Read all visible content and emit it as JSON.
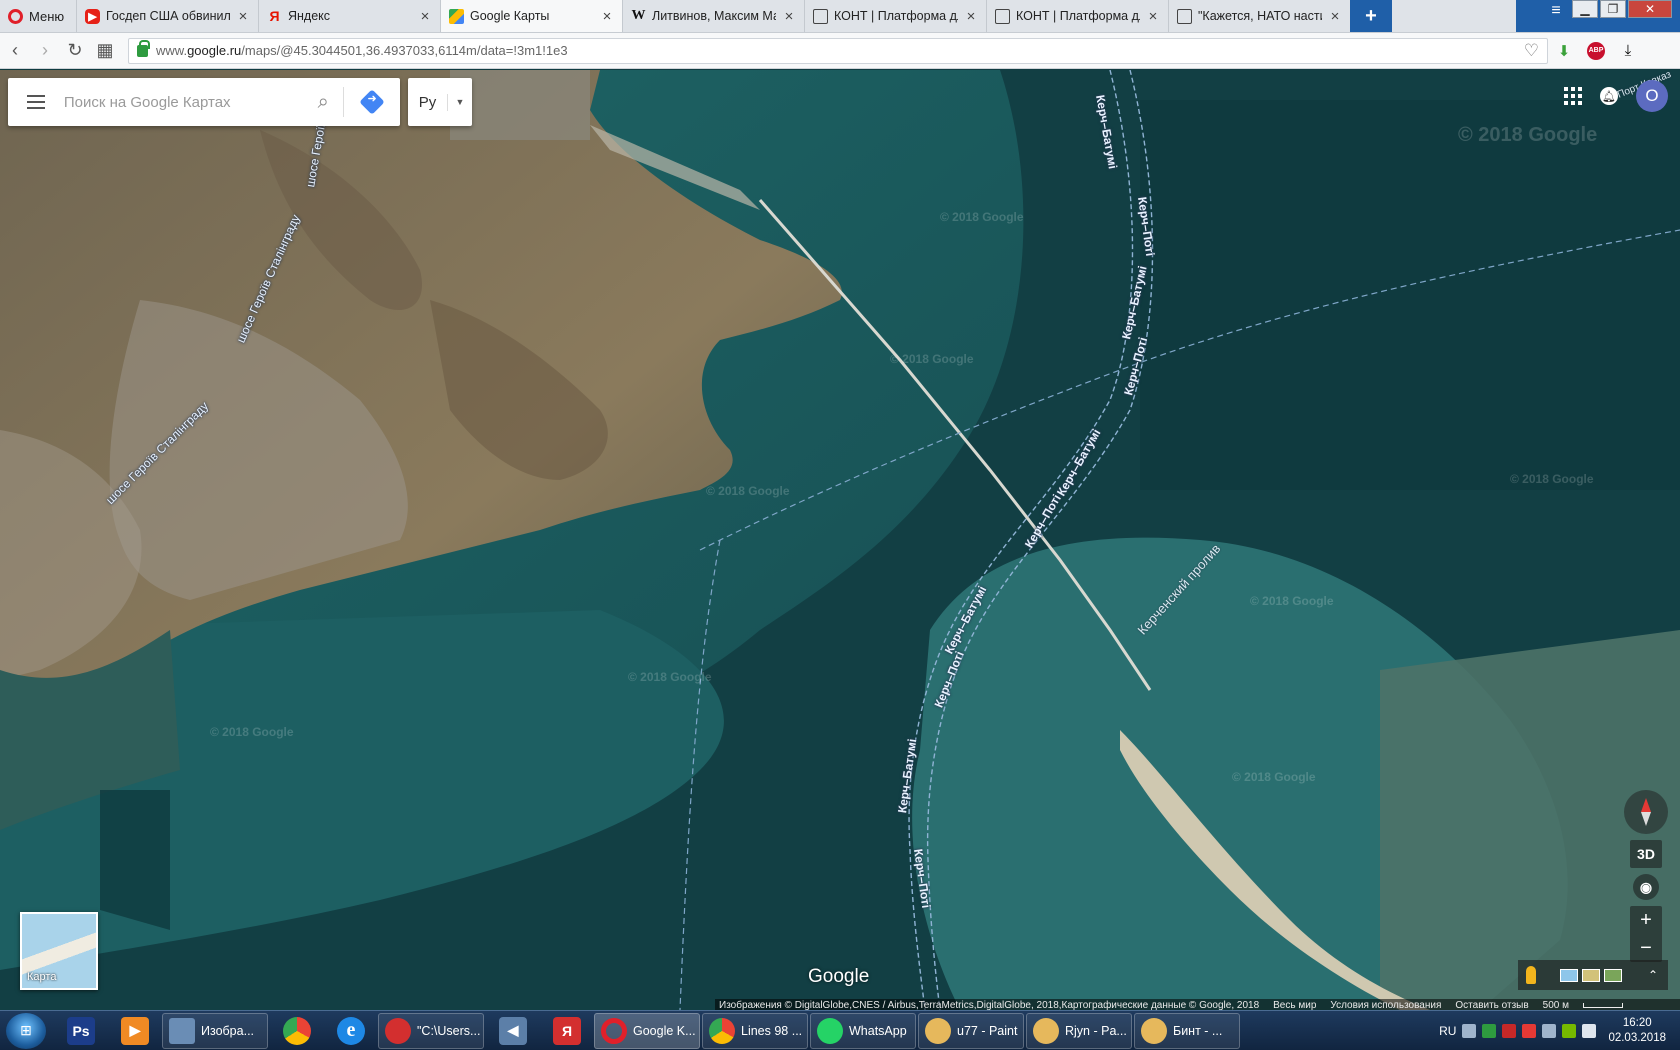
{
  "browser": {
    "menu_label": "Меню",
    "tabs": [
      {
        "title": "Госдеп США обвинил Рос",
        "favicon": "youtube-icon",
        "active": false
      },
      {
        "title": "Яндекс",
        "favicon": "yandex-icon",
        "active": false
      },
      {
        "title": "Google Карты",
        "favicon": "google-maps-icon",
        "active": true
      },
      {
        "title": "Литвинов, Максим Макси",
        "favicon": "wikipedia-icon",
        "active": false
      },
      {
        "title": "КОНТ | Платформа для со",
        "favicon": "edit-icon",
        "active": false
      },
      {
        "title": "КОНТ | Платформа для со",
        "favicon": "edit-icon",
        "active": false
      },
      {
        "title": "\"Кажется, НАТО настиг ж",
        "favicon": "edit-icon",
        "active": false
      }
    ],
    "url_prefix": "www.",
    "url_domain": "google.ru",
    "url_path": "/maps/@45.3044501,36.4937033,6114m/data=!3m1!1e3"
  },
  "maps": {
    "search_placeholder": "Поиск на Google Картах",
    "language_label": "Ру",
    "avatar_letter": "О",
    "route_labels": [
      "Керч–Батумі",
      "Керч–Поті",
      "Керч–Батумі",
      "Керч–Поті",
      "Керч–Батумі",
      "Керч–Поті",
      "Керч–Батумі",
      "Керч–Поті",
      "Керч–Батумі",
      "Керч–Поті"
    ],
    "road_labels": [
      "шосе Героїв Сталінграду",
      "шосе Героїв Сталінграду",
      "шосе Героїв"
    ],
    "strait_label": "Керченский пролив",
    "port_label": "Порт Кавказ",
    "watermark": "© 2018 Google",
    "big_watermark": "© 2018 Google",
    "minimap_label": "Карта",
    "control_3d": "3D",
    "zoom_in": "+",
    "zoom_out": "−",
    "logo": "Google",
    "attribution": "Изображения © DigitalGlobe,CNES / Airbus,TerraMetrics,DigitalGlobe, 2018,Картографические данные © Google, 2018",
    "world_link": "Весь мир",
    "terms_link": "Условия использования",
    "feedback_link": "Оставить отзыв",
    "scale_label": "500 м"
  },
  "taskbar": {
    "apps": [
      {
        "label": "Изобра...",
        "color": "#6a8db5"
      },
      {
        "label": "\"C:\\Users...",
        "color": "#d32f2f"
      },
      {
        "label": "Google K...",
        "color": "#e0202a",
        "active": true
      },
      {
        "label": "Lines 98 ...",
        "color": "#4285f4"
      },
      {
        "label": "WhatsApp",
        "color": "#25d366"
      },
      {
        "label": "u77 - Paint",
        "color": "#e6b85c"
      },
      {
        "label": "Rjyn - Pa...",
        "color": "#e6b85c"
      },
      {
        "label": "Бинт - ...",
        "color": "#e6b85c"
      }
    ],
    "pinned": [
      {
        "icon": "photoshop-icon",
        "text": "Ps",
        "color": "#1c3d8a"
      },
      {
        "icon": "media-player-icon",
        "text": "▶",
        "color": "#f08a24"
      },
      {
        "icon": "chrome-icon",
        "text": "",
        "color": "#4285f4"
      },
      {
        "icon": "ie-icon",
        "text": "e",
        "color": "#1e88e5"
      },
      {
        "icon": "speaker-app-icon",
        "text": "◀",
        "color": "#5c7fa8"
      },
      {
        "icon": "yandex-browser-icon",
        "text": "Я",
        "color": "#d32f2f"
      }
    ],
    "language": "RU",
    "time": "16:20",
    "date": "02.03.2018"
  }
}
